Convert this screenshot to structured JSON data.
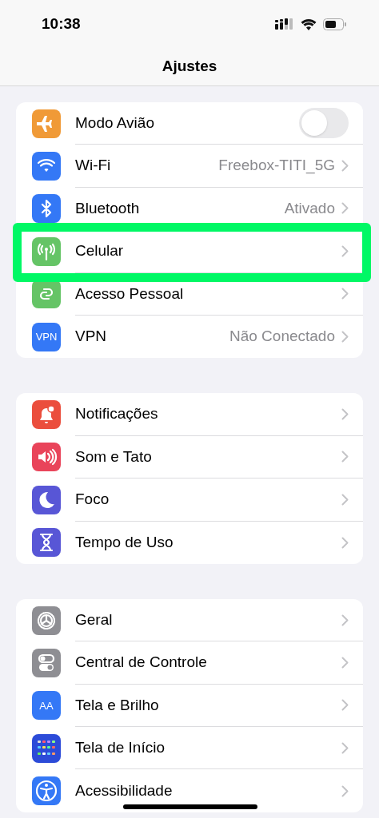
{
  "status_bar": {
    "time": "10:38"
  },
  "title": "Ajustes",
  "groups": [
    {
      "rows": [
        {
          "color": "#f09a37",
          "label": "Modo Avião",
          "kind": "toggle",
          "on": false
        },
        {
          "color": "#3478f6",
          "label": "Wi-Fi",
          "kind": "value",
          "value": "Freebox-TITI_5G"
        },
        {
          "color": "#3478f6",
          "label": "Bluetooth",
          "kind": "value",
          "value": "Ativado"
        },
        {
          "color": "#65c466",
          "label": "Celular",
          "kind": "value",
          "highlighted": true
        },
        {
          "color": "#65c466",
          "label": "Acesso Pessoal",
          "kind": "value"
        },
        {
          "icon_text": "VPN",
          "color": "#3478f6",
          "label": "VPN",
          "kind": "value",
          "value": "Não Conectado"
        }
      ]
    },
    {
      "rows": [
        {
          "color": "#eb4e3d",
          "label": "Notificações",
          "kind": "value"
        },
        {
          "color": "#e9445a",
          "label": "Som e Tato",
          "kind": "value"
        },
        {
          "color": "#5856d6",
          "label": "Foco",
          "kind": "value"
        },
        {
          "color": "#5856d6",
          "label": "Tempo de Uso",
          "kind": "value"
        }
      ]
    },
    {
      "rows": [
        {
          "color": "#8e8e93",
          "label": "Geral",
          "kind": "value"
        },
        {
          "color": "#8e8e93",
          "label": "Central de Controle",
          "kind": "value"
        },
        {
          "icon_text": "AA",
          "color": "#3478f6",
          "label": "Tela e Brilho",
          "kind": "value"
        },
        {
          "color": "#2c4bd8",
          "label": "Tela de Início",
          "kind": "value"
        },
        {
          "color": "#3478f6",
          "label": "Acessibilidade",
          "kind": "value"
        }
      ]
    }
  ]
}
